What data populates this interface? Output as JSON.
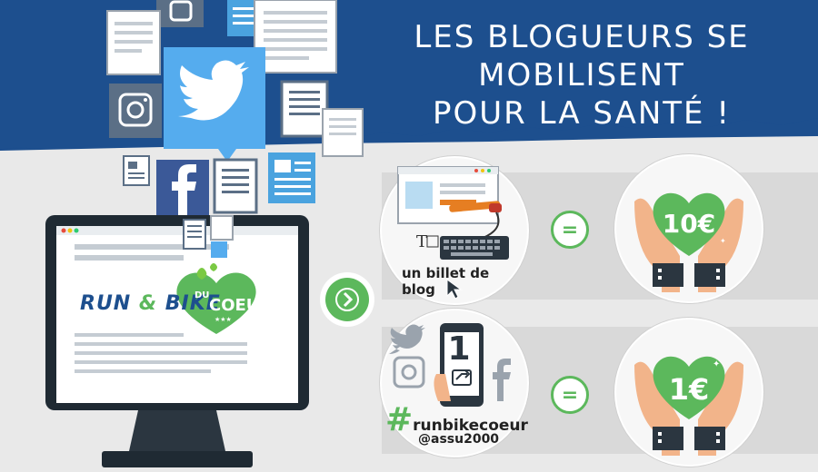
{
  "headline": {
    "line1": "LES BLOGUEURS SE MOBILISENT",
    "line2": "POUR LA SANTÉ !"
  },
  "logo": {
    "run": "RUN",
    "amp": "&",
    "bike": "BIKE",
    "du": "DU",
    "coeur": "COEUR",
    "stars": "★★★"
  },
  "row1": {
    "caption": "un billet de blog",
    "amount": "10€"
  },
  "row2": {
    "phone_count": "1",
    "hashtag_symbol": "#",
    "hashtag": "runbikecoeur",
    "handle": "@assu2000",
    "amount": "1€"
  },
  "equals": "=",
  "colors": {
    "blue_top": "#1d4f8e",
    "green": "#5cb85c",
    "twitter": "#55acee",
    "facebook": "#3b5998",
    "instagram_gray": "#5b6f86"
  }
}
